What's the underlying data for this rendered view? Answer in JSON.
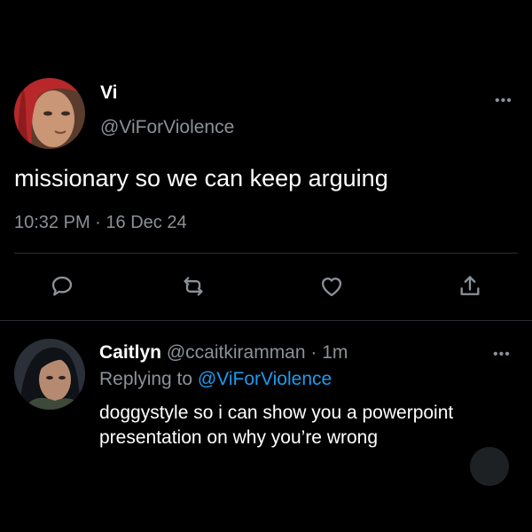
{
  "main_tweet": {
    "author_name": "Vi",
    "author_handle": "@ViForViolence",
    "text": "missionary so we can keep arguing",
    "time": "10:32 PM",
    "separator": "·",
    "date": "16 Dec 24",
    "more_glyph": "•••"
  },
  "actions": {
    "reply_icon": "reply-bubble-icon",
    "retweet_icon": "retweet-icon",
    "like_icon": "heart-icon",
    "share_icon": "share-icon"
  },
  "reply_tweet": {
    "author_name": "Caitlyn",
    "author_handle": "@ccaitkiramman",
    "separator": "·",
    "time_ago": "1m",
    "replying_label": "Replying to",
    "replying_to": "@ViForViolence",
    "text": "doggystyle so i can show you a powerpoint presentation on why you’re wrong",
    "more_glyph": "•••"
  },
  "colors": {
    "background": "#000000",
    "text_primary": "#ffffff",
    "text_secondary": "#8b9197",
    "mention_blue": "#1d9bf0",
    "divider": "#2a2d31"
  }
}
